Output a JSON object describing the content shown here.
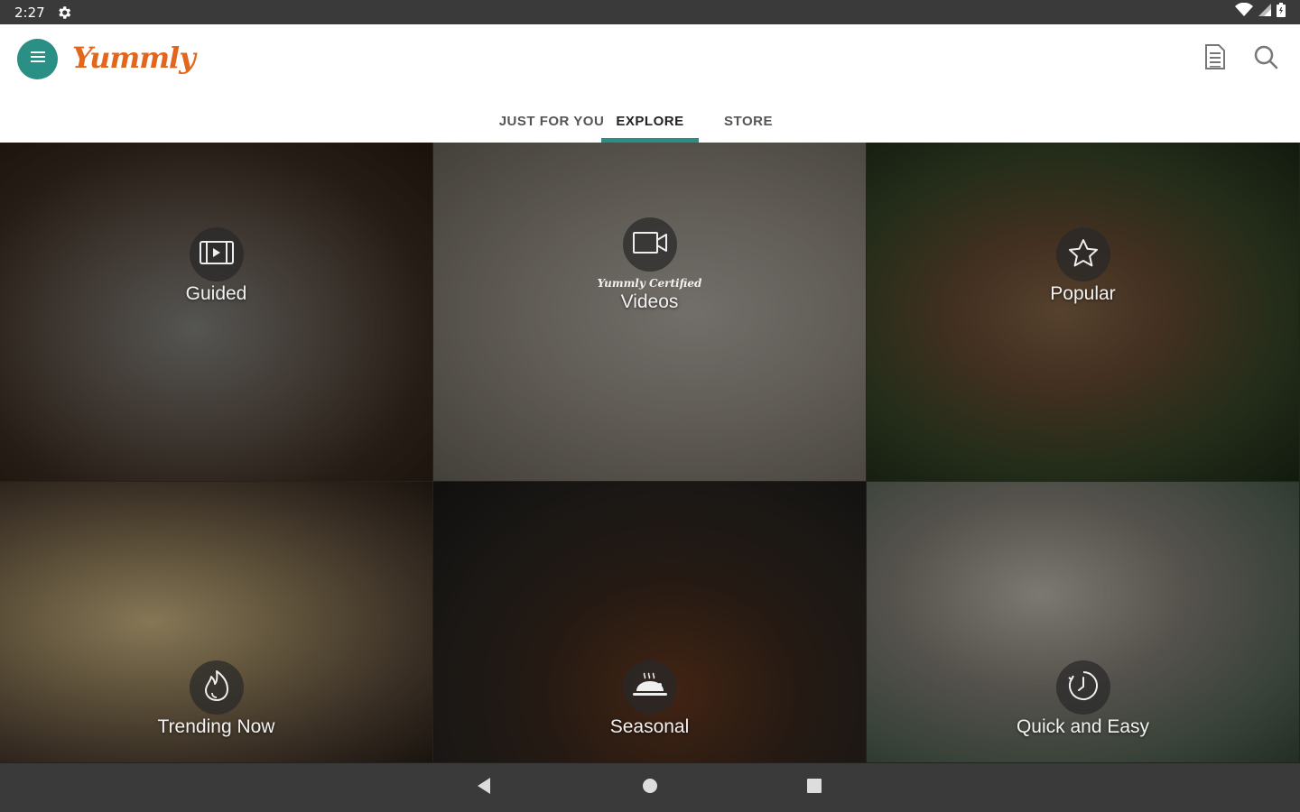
{
  "status_bar": {
    "time": "2:27"
  },
  "app": {
    "logo_text": "Yummly",
    "brand_color": "#e2671d",
    "accent_color": "#2a8f84"
  },
  "tabs": [
    {
      "label": "JUST FOR YOU",
      "active": false
    },
    {
      "label": "EXPLORE",
      "active": true
    },
    {
      "label": "STORE",
      "active": false
    }
  ],
  "tiles": [
    {
      "label": "Guided",
      "icon": "video-play-icon"
    },
    {
      "label": "Videos",
      "subtitle": "Yummly Certified",
      "icon": "video-camera-icon"
    },
    {
      "label": "Popular",
      "icon": "star-icon"
    },
    {
      "label": "Trending Now",
      "icon": "flame-icon"
    },
    {
      "label": "Seasonal",
      "icon": "hot-dish-icon"
    },
    {
      "label": "Quick and Easy",
      "icon": "timer-icon"
    }
  ]
}
